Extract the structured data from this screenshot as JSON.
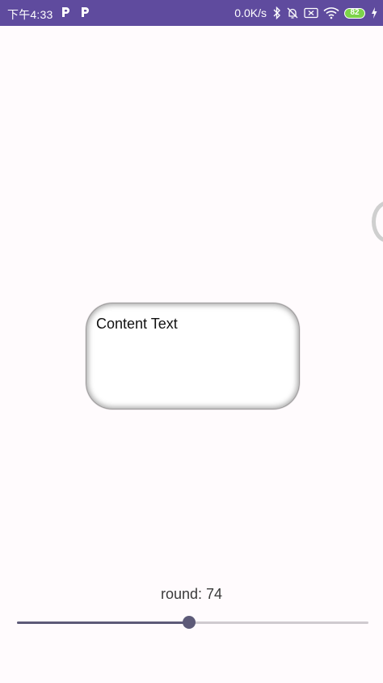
{
  "status_bar": {
    "time": "下午4:33",
    "net_speed": "0.0K/s",
    "battery_level": "82",
    "background_color": "#5f4b9e",
    "icons": [
      "p-app-icon",
      "p-app-icon",
      "bluetooth-icon",
      "alarm-off-icon",
      "sim-x-icon",
      "wifi-icon",
      "battery-icon",
      "charging-icon"
    ]
  },
  "card": {
    "text": "Content Text"
  },
  "slider": {
    "label": "round: 74",
    "fraction": 0.49,
    "track_color": "#cfcacf",
    "fill_color": "#5d5a78"
  }
}
